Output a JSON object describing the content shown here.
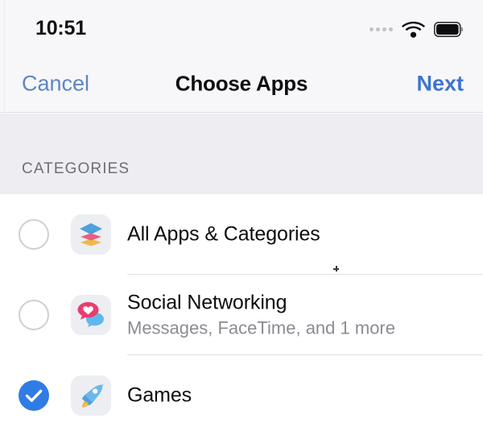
{
  "status_bar": {
    "time": "10:51",
    "signal_icon": "signal-dots-icon",
    "wifi_icon": "wifi-icon",
    "battery_icon": "battery-full-icon"
  },
  "nav_bar": {
    "cancel_label": "Cancel",
    "title": "Choose Apps",
    "next_label": "Next"
  },
  "list": {
    "section_header": "CATEGORIES",
    "rows": [
      {
        "title": "All Apps & Categories",
        "subtitle": "",
        "icon": "layers-stack-icon",
        "selected": false
      },
      {
        "title": "Social Networking",
        "subtitle": "Messages, FaceTime, and 1 more",
        "icon": "chat-bubble-heart-icon",
        "selected": true
      },
      {
        "title": "Games",
        "subtitle": "",
        "icon": "rocket-icon",
        "selected": false
      }
    ]
  },
  "colors": {
    "accent_blue": "#2f7ce5",
    "cancel_blue": "#5e86c4",
    "next_blue": "#3f74cf",
    "group_background": "#eeeef2",
    "nav_background": "#f7f7f9",
    "separator": "#e2e2e6",
    "secondary_text": "#8b8b93",
    "section_header_text": "#6e6e77"
  }
}
